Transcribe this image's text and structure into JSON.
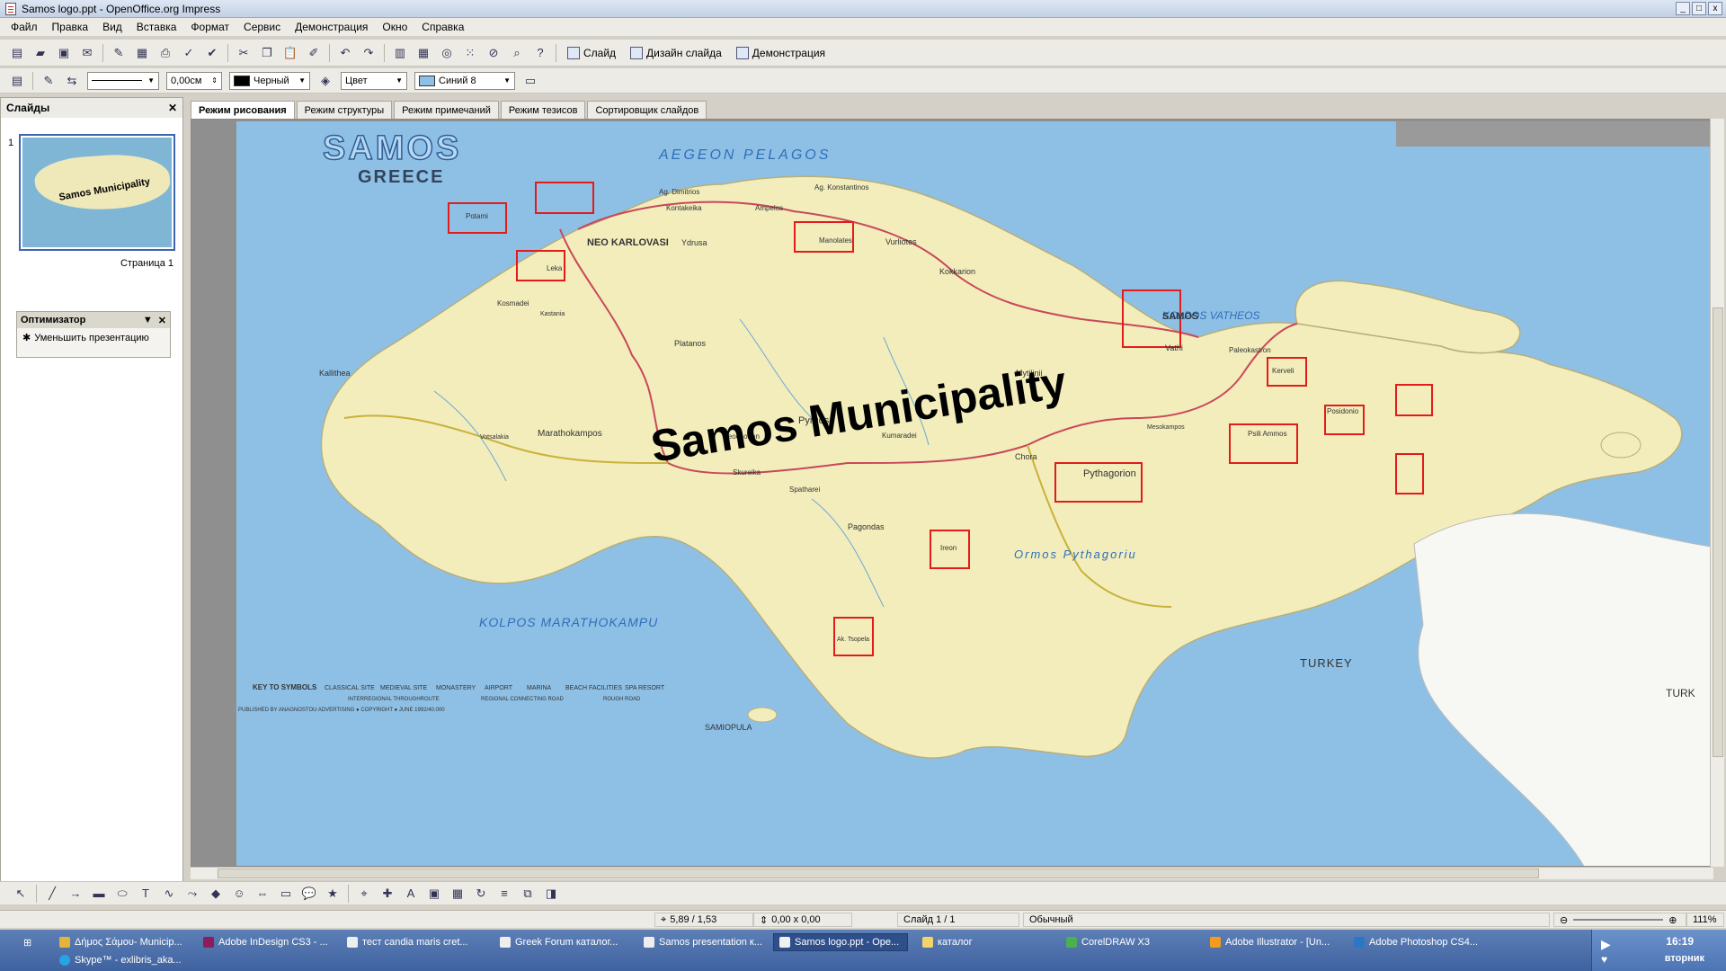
{
  "window": {
    "title": "Samos logo.ppt - OpenOffice.org Impress",
    "controls": [
      "_",
      "□",
      "x"
    ]
  },
  "menu": [
    "Файл",
    "Правка",
    "Вид",
    "Вставка",
    "Формат",
    "Сервис",
    "Демонстрация",
    "Окно",
    "Справка"
  ],
  "toolbar": {
    "slide_label": "Слайд",
    "design_label": "Дизайн слайда",
    "show_label": "Демонстрация",
    "line_width": "0,00см",
    "line_color": "Черный",
    "area_style": "Цвет",
    "area_color": "Синий 8",
    "line_color_hex": "#000000",
    "area_color_hex": "#8ec0e6"
  },
  "slides_panel": {
    "title": "Слайды",
    "slide_number": "1",
    "page_label": "Страница 1",
    "thumb_text": "Samos Municipality"
  },
  "optimizer": {
    "title": "Оптимизатор",
    "item": "Уменьшить презентацию"
  },
  "tabs": [
    "Режим рисования",
    "Режим структуры",
    "Режим примечаний",
    "Режим тезисов",
    "Сортировщик слайдов"
  ],
  "slide": {
    "heading": "Samos Municipality",
    "map_title": "SAMOS",
    "map_subtitle": "GREECE",
    "sea_north": "AEGEON PELAGOS",
    "sea_south": "KOLPOS MARATHOKAMPU",
    "bay_east": "KOLPOS VATHEOS",
    "bay_south": "Ormos Pythagoriu",
    "turkey": "TURKEY",
    "turkey_right": "TURK",
    "samopula": "SAMIOPULA",
    "places": {
      "neo_karlovasi": "NEO KARLOVASI",
      "samos_town": "SAMOS",
      "pythagorion": "Pythagorion",
      "pyrgos": "Pyrgos",
      "marathokampos": "Marathokampos",
      "kallithea": "Kallithea",
      "vathi": "Vathi",
      "mytilinii": "Mytilinii",
      "kokkarion": "Kokkarion",
      "vourliotes": "Vurliotes",
      "manolates": "Manolates",
      "platanos": "Platanos",
      "chora": "Chora",
      "heraion": "Ireon",
      "pagondas": "Pagondas",
      "spatharei": "Spatharei",
      "koumaradei": "Kumaradei",
      "kosmadei": "Kosmadei",
      "ydrusa": "Ydrusa",
      "leka": "Leka",
      "potami": "Potami",
      "kerveli": "Kerveli",
      "posidonio": "Posidonio",
      "psili_ammos": "Psili Ammos",
      "tsopela": "Ak. Tsopela",
      "ag_konstantinos": "Ag. Konstantinos",
      "kontakeika": "Kontakeika",
      "ampelos": "Ampelos",
      "ag_dimitrios": "Ag. Dimitrios",
      "neochorion": "Neochorion",
      "skureika": "Skureika",
      "votsalakia": "Votsalakia",
      "kastania": "Kastania",
      "paleokastron": "Paleokastron",
      "mesokampos": "Mesokampos"
    },
    "legend": {
      "key": "KEY TO SYMBOLS",
      "items": [
        "CLASSICAL SITE",
        "MEDIEVAL SITE",
        "MONASTERY",
        "AIRPORT",
        "MARINA",
        "BEACH FACILITIES",
        "SPA RESORT"
      ],
      "roads": [
        "INTERREGIONAL THROUGHROUTE",
        "REGIONAL CONNECTING ROAD",
        "ROUGH ROAD"
      ],
      "credit": "PUBLISHED BY ANAGNOSTOU ADVERTISING ● COPYRIGHT ● JUNE 1992/40.000"
    }
  },
  "status": {
    "position": "5,89 / 1,53",
    "size": "0,00 x 0,00",
    "slide": "Слайд 1 / 1",
    "layout": "Обычный",
    "zoom": "111%"
  },
  "taskbar": {
    "tasks": [
      "Δήμος Σάμου- Municip...",
      "Adobe InDesign CS3 - ...",
      "тест candia maris cret...",
      "Greek Forum каталог...",
      "Samos presentation к...",
      "Samos logo.ppt - Ope...",
      "каталог",
      "CorelDRAW X3",
      "Adobe Illustrator - [Un...",
      "Adobe Photoshop CS4..."
    ],
    "skype": "Skype™ - exlibris_aka...",
    "time": "16:19",
    "day": "вторник"
  }
}
